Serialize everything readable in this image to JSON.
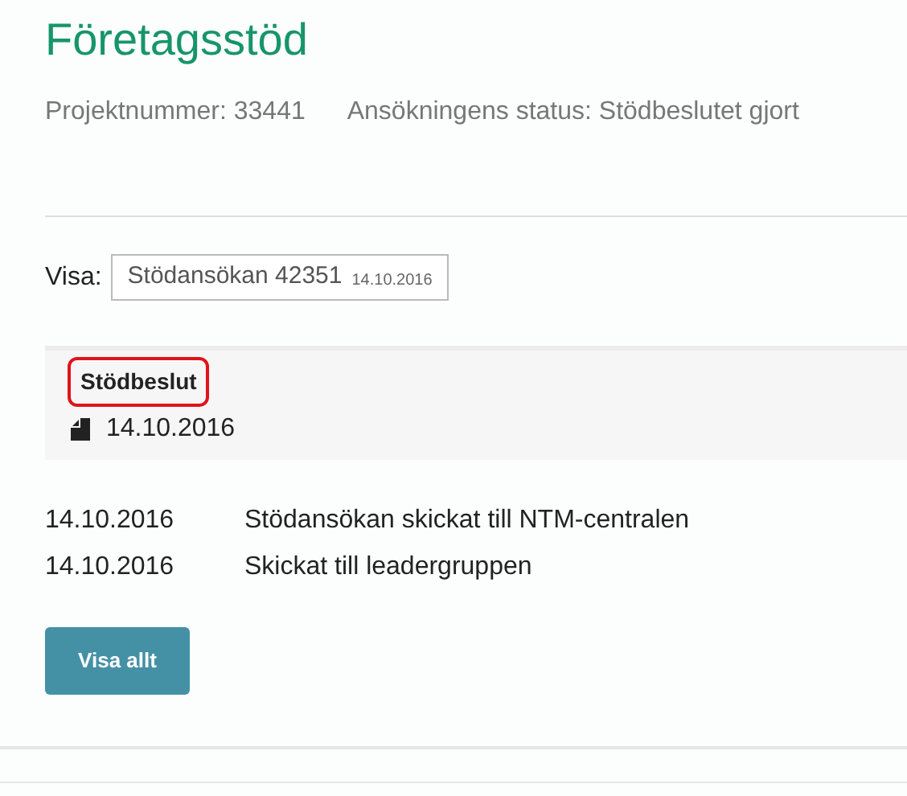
{
  "title": "Företagsstöd",
  "meta": [
    {
      "label": "Projektnummer: 33441"
    },
    {
      "label": "Ansökningens status: Stödbeslutet gjort"
    }
  ],
  "view_selector": {
    "label": "Visa:",
    "value": "Stödansökan 42351",
    "date": "14.10.2016"
  },
  "decision": {
    "title": "Stödbeslut",
    "highlighted": true,
    "date": "14.10.2016"
  },
  "events": [
    {
      "date": "14.10.2016",
      "text": "Stödansökan skickat till NTM-centralen"
    },
    {
      "date": "14.10.2016",
      "text": "Skickat till leadergruppen"
    }
  ],
  "button": "Visa allt"
}
